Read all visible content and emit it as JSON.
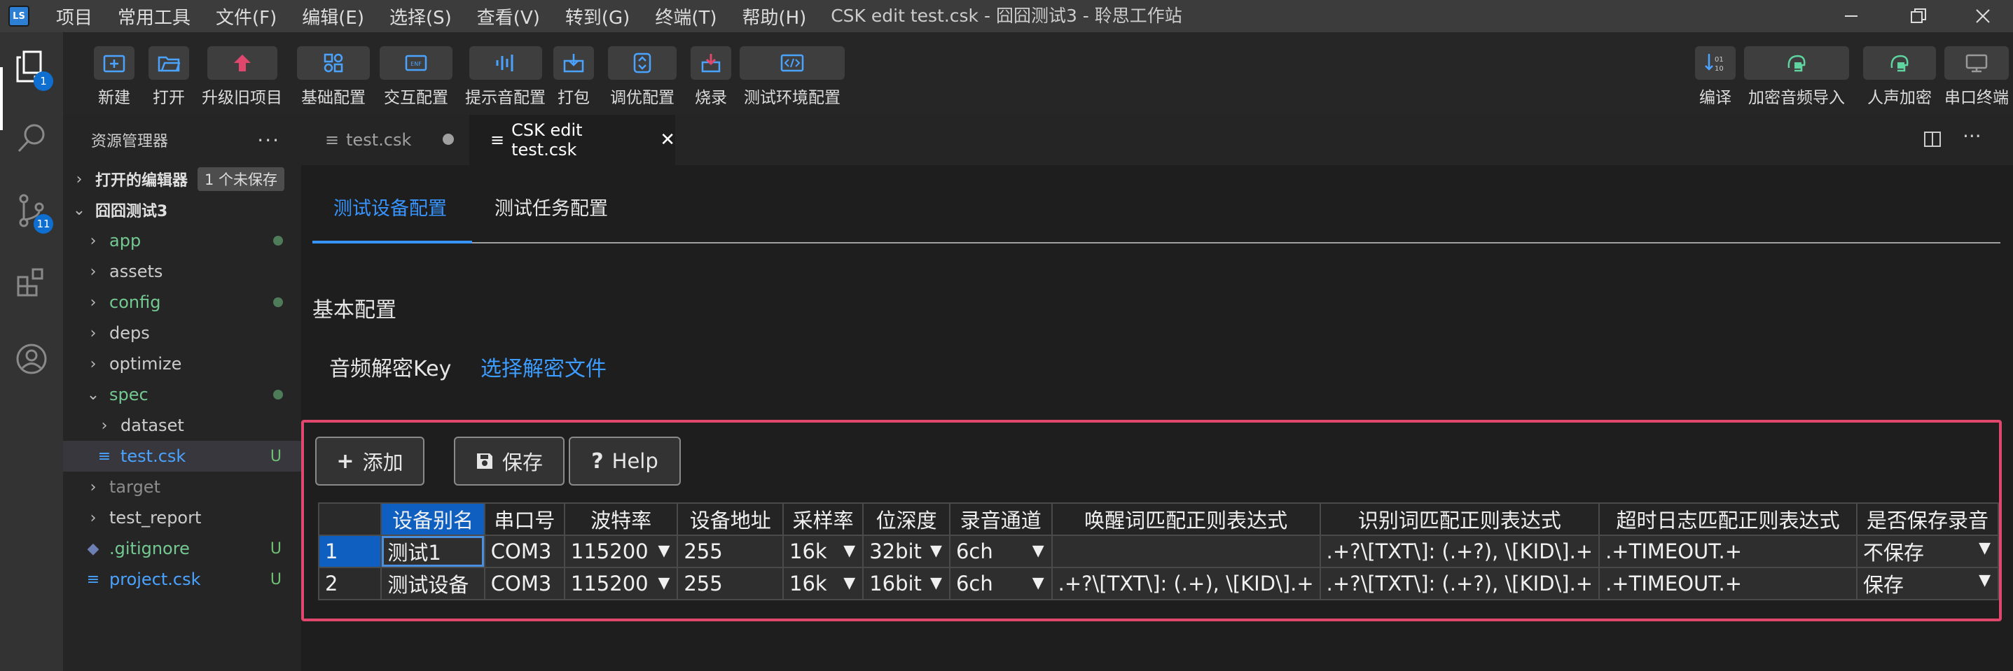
{
  "titlebar": {
    "app_logo": "LS",
    "menu": [
      "项目",
      "常用工具",
      "文件(F)",
      "编辑(E)",
      "选择(S)",
      "查看(V)",
      "转到(G)",
      "终端(T)",
      "帮助(H)"
    ],
    "window_title": "CSK edit test.csk - 囧囧测试3 - 聆思工作站"
  },
  "activity": {
    "explorer_badge": "1",
    "scm_badge": "11"
  },
  "toolbar": {
    "left": [
      {
        "label": "新建",
        "icon": "new-file-icon"
      },
      {
        "label": "打开",
        "icon": "open-folder-icon"
      },
      {
        "label": "升级旧项目",
        "icon": "upgrade-icon"
      },
      {
        "label": "基础配置",
        "icon": "basic-config-icon"
      },
      {
        "label": "交互配置",
        "icon": "interaction-config-icon"
      },
      {
        "label": "提示音配置",
        "icon": "audio-config-icon"
      },
      {
        "label": "打包",
        "icon": "package-icon"
      },
      {
        "label": "调优配置",
        "icon": "tuning-icon"
      },
      {
        "label": "烧录",
        "icon": "flash-icon"
      },
      {
        "label": "测试环境配置",
        "icon": "code-icon"
      }
    ],
    "right": [
      {
        "label": "编译",
        "icon": "compile-icon"
      },
      {
        "label": "加密音频导入",
        "icon": "encrypted-audio-icon"
      },
      {
        "label": "人声加密",
        "icon": "voice-encrypt-icon"
      },
      {
        "label": "串口终端",
        "icon": "monitor-icon"
      }
    ]
  },
  "explorer": {
    "title": "资源管理器",
    "open_editors": "打开的编辑器",
    "unsaved_badge": "1 个未保存",
    "project": "囧囧测试3",
    "items": [
      {
        "name": "app",
        "status": "dot"
      },
      {
        "name": "assets",
        "status": ""
      },
      {
        "name": "config",
        "status": "dot"
      },
      {
        "name": "deps",
        "status": ""
      },
      {
        "name": "optimize",
        "status": ""
      },
      {
        "name": "spec",
        "status": "dot"
      },
      {
        "name": "dataset",
        "status": ""
      },
      {
        "name": "test.csk",
        "status": "U"
      },
      {
        "name": "target",
        "status": ""
      },
      {
        "name": "test_report",
        "status": ""
      },
      {
        "name": ".gitignore",
        "status": "U"
      },
      {
        "name": "project.csk",
        "status": "U"
      }
    ]
  },
  "tabs": [
    {
      "label": "test.csk"
    },
    {
      "label": "CSK edit test.csk"
    }
  ],
  "editor": {
    "subtabs": [
      "测试设备配置",
      "测试任务配置"
    ],
    "section_title": "基本配置",
    "key_label": "音频解密Key",
    "key_link": "选择解密文件",
    "buttons": {
      "add": "添加",
      "save": "保存",
      "help": "Help"
    },
    "table": {
      "headers": [
        "设备别名",
        "串口号",
        "波特率",
        "设备地址",
        "采样率",
        "位深度",
        "录音通道",
        "唤醒词匹配正则表达式",
        "识别词匹配正则表达式",
        "超时日志匹配正则表达式",
        "是否保存录音"
      ],
      "rows": [
        {
          "num": "1",
          "cells": [
            "测试1",
            "COM3",
            "115200",
            "255",
            "16k",
            "32bit",
            "6ch",
            "",
            ".+?\\[TXT\\]: (.+?), \\[KID\\].+",
            ".+TIMEOUT.+",
            "不保存"
          ]
        },
        {
          "num": "2",
          "cells": [
            "测试设备",
            "COM3",
            "115200",
            "255",
            "16k",
            "16bit",
            "6ch",
            ".+?\\[TXT\\]: (.+), \\[KID\\].+",
            ".+?\\[TXT\\]: (.+?), \\[KID\\].+",
            ".+TIMEOUT.+",
            "保存"
          ]
        }
      ]
    }
  }
}
